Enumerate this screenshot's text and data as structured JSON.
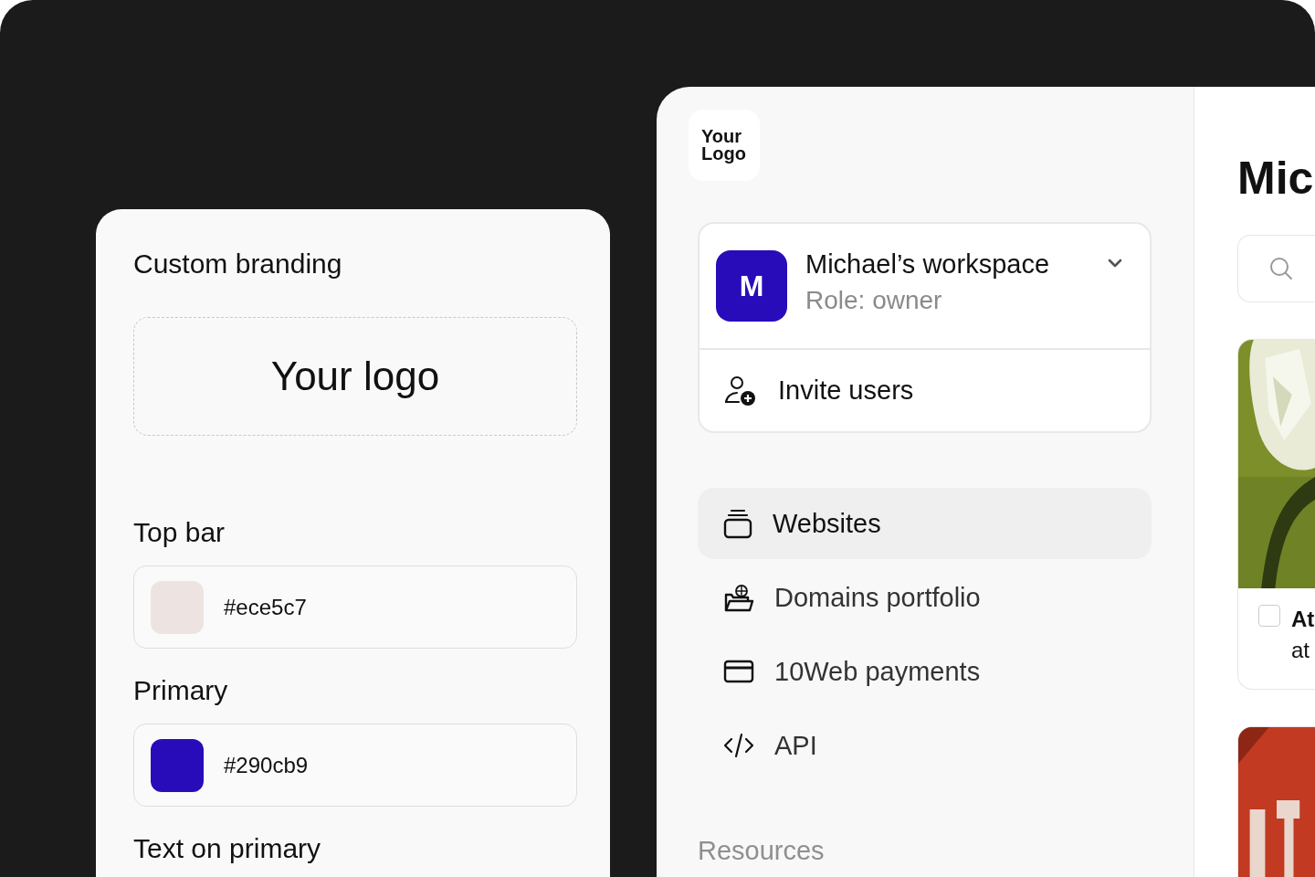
{
  "branding": {
    "title": "Custom branding",
    "logo_placeholder": "Your logo",
    "colors": [
      {
        "label": "Top bar",
        "value": "#ece5c7",
        "color": "#ede4e1"
      },
      {
        "label": "Primary",
        "value": "#290cb9",
        "color": "#290cb9"
      },
      {
        "label": "Text on primary"
      }
    ]
  },
  "sidebar": {
    "logo": "Your Logo",
    "workspace": {
      "avatar": "M",
      "name": "Michael’s workspace",
      "role": "Role: owner",
      "expanded": false
    },
    "invite": "Invite users",
    "items": [
      {
        "label": "Websites",
        "kind": "websites",
        "selected": true
      },
      {
        "label": "Domains portfolio",
        "kind": "domains",
        "selected": false
      },
      {
        "label": "10Web payments",
        "kind": "payments",
        "selected": false
      },
      {
        "label": "API",
        "kind": "api",
        "selected": false
      }
    ],
    "section": "Resources"
  },
  "main": {
    "title": "Mic",
    "cards": [
      {
        "kind": "flower",
        "title": "At",
        "subtitle": "at",
        "checked": false
      },
      {
        "kind": "sign"
      }
    ]
  }
}
